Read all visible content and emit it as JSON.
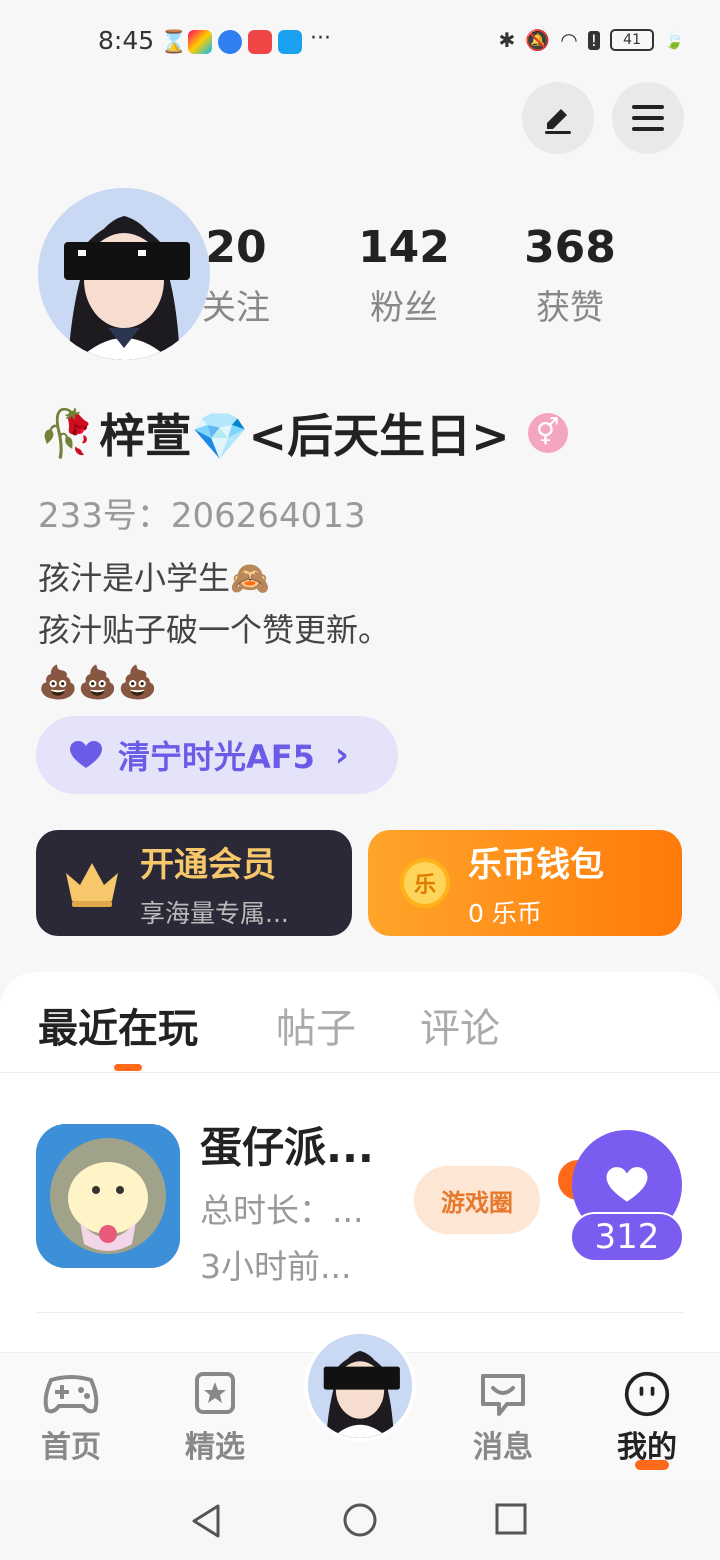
{
  "status": {
    "time": "8:45",
    "dots": "···",
    "battery": "41"
  },
  "profile": {
    "stats": [
      {
        "num": "20",
        "label": "关注"
      },
      {
        "num": "142",
        "label": "粉丝"
      },
      {
        "num": "368",
        "label": "获赞"
      }
    ],
    "name": "梓萱💎<后天生日>",
    "name_prefix_emoji": "🥀",
    "gender_symbol": "⚥",
    "uid": "233号：206264013",
    "bio": [
      "孩汁是小学生🙈",
      "孩汁贴子破一个赞更新。",
      "💩💩💩"
    ],
    "tag": "清宁时光AF5",
    "tag_arrow": "›"
  },
  "cards": {
    "vip": {
      "title": "开通会员",
      "sub": "享海量专属..."
    },
    "wallet": {
      "title": "乐币钱包",
      "sub": "0 乐币",
      "coin_char": "乐"
    }
  },
  "tabs": [
    {
      "label": "最近在玩",
      "active": true
    },
    {
      "label": "帖子",
      "active": false
    },
    {
      "label": "评论",
      "active": false
    }
  ],
  "game": {
    "title": "蛋仔派...",
    "total_time": "总时长：...",
    "last_played": "3小时前...",
    "circle_button": "游戏圈",
    "like_count": "312"
  },
  "bottom_nav": [
    {
      "label": "首页",
      "icon": "gamepad-icon"
    },
    {
      "label": "精选",
      "icon": "star-icon"
    },
    {
      "label": "消息",
      "icon": "chat-icon"
    },
    {
      "label": "我的",
      "icon": "smiley-icon",
      "active": true
    }
  ],
  "colors": {
    "accent": "#ff6a1a",
    "purple": "#7a5cf0",
    "vip_gold": "#f6c86b",
    "wallet_orange": "#ff8f1a"
  }
}
